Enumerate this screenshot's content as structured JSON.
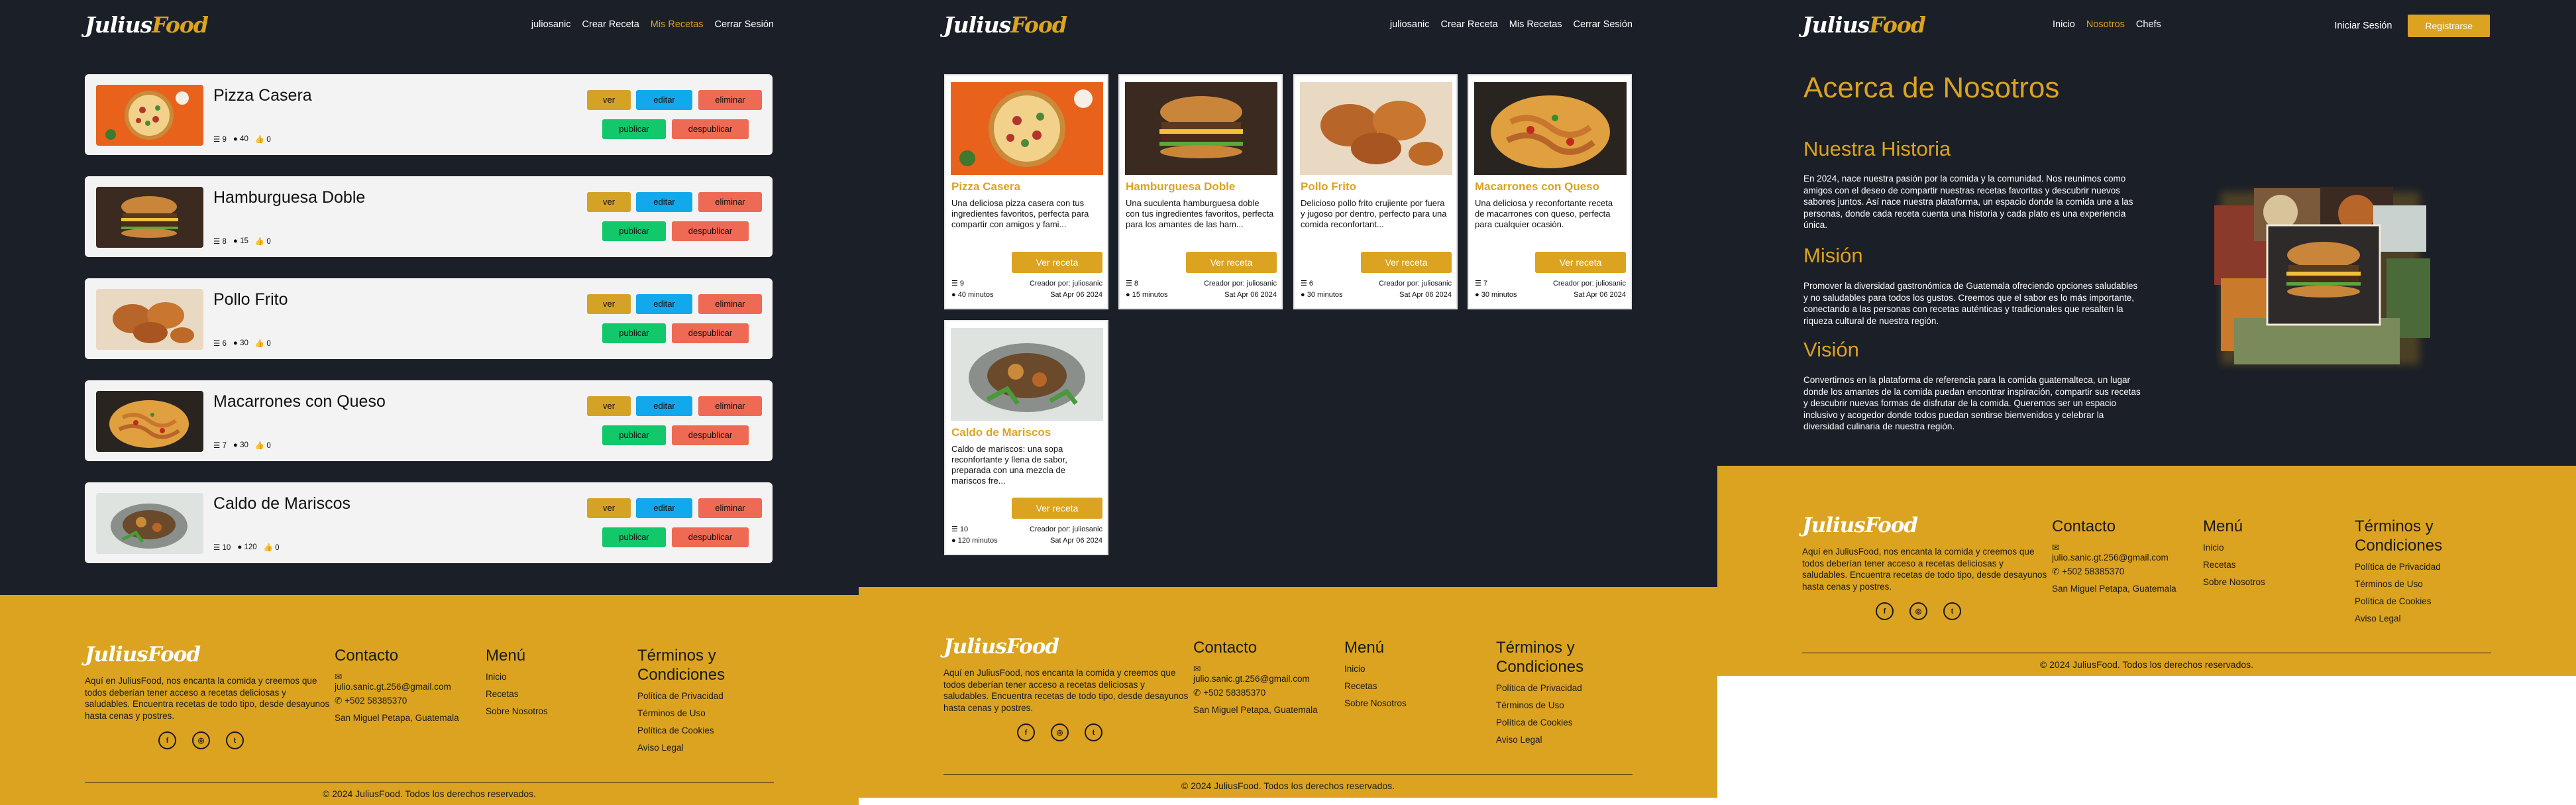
{
  "brand": {
    "part1": "Julius",
    "part2": "Food"
  },
  "nav_auth": {
    "user": "juliosanic",
    "create": "Crear Receta",
    "mine": "Mis Recetas",
    "logout": "Cerrar Sesión"
  },
  "nav_public": {
    "home": "Inicio",
    "about": "Nosotros",
    "chefs": "Chefs",
    "login": "Iniciar Sesión",
    "register": "Registrarse"
  },
  "buttons": {
    "view": "ver",
    "edit": "editar",
    "delete": "eliminar",
    "publish": "publicar",
    "unpublish": "despublicar",
    "view_recipe": "Ver receta"
  },
  "my_recipes": [
    {
      "title": "Pizza Casera",
      "ingredients": "9",
      "minutes": "40",
      "likes": "0"
    },
    {
      "title": "Hamburguesa Doble",
      "ingredients": "8",
      "minutes": "15",
      "likes": "0"
    },
    {
      "title": "Pollo Frito",
      "ingredients": "6",
      "minutes": "30",
      "likes": "0"
    },
    {
      "title": "Macarrones con Queso",
      "ingredients": "7",
      "minutes": "30",
      "likes": "0"
    },
    {
      "title": "Caldo de Mariscos",
      "ingredients": "10",
      "minutes": "120",
      "likes": "0"
    }
  ],
  "grid_recipes": [
    {
      "title": "Pizza Casera",
      "desc": "Una deliciosa pizza casera con tus ingredientes favoritos, perfecta para compartir con amigos y fami...",
      "ingredients": "9",
      "minutes": "40 minutos",
      "creator": "Creador por: juliosanic",
      "date": "Sat Apr 06 2024"
    },
    {
      "title": "Hamburguesa Doble",
      "desc": "Una suculenta hamburguesa doble con tus ingredientes favoritos, perfecta para los amantes de las ham...",
      "ingredients": "8",
      "minutes": "15 minutos",
      "creator": "Creador por: juliosanic",
      "date": "Sat Apr 06 2024"
    },
    {
      "title": "Pollo Frito",
      "desc": "Delicioso pollo frito crujiente por fuera y jugoso por dentro, perfecto para una comida reconfortant...",
      "ingredients": "6",
      "minutes": "30 minutos",
      "creator": "Creador por: juliosanic",
      "date": "Sat Apr 06 2024"
    },
    {
      "title": "Macarrones con Queso",
      "desc": "Una deliciosa y reconfortante receta de macarrones con queso, perfecta para cualquier ocasión.",
      "ingredients": "7",
      "minutes": "30 minutos",
      "creator": "Creador por: juliosanic",
      "date": "Sat Apr 06 2024"
    },
    {
      "title": "Caldo de Mariscos",
      "desc": "Caldo de mariscos: una sopa reconfortante y llena de sabor, preparada con una mezcla de mariscos fre...",
      "ingredients": "10",
      "minutes": "120 minutos",
      "creator": "Creador por: juliosanic",
      "date": "Sat Apr 06 2024"
    }
  ],
  "about": {
    "title": "Acerca de Nosotros",
    "history_title": "Nuestra Historia",
    "history": "En 2024, nace nuestra pasión por la comida y la comunidad. Nos reunimos como amigos con el deseo de compartir nuestras recetas favoritas y descubrir nuevos sabores juntos. Así nace nuestra plataforma, un espacio donde la comida une a las personas, donde cada receta cuenta una historia y cada plato es una experiencia única.",
    "mission_title": "Misión",
    "mission": "Promover la diversidad gastronómica de Guatemala ofreciendo opciones saludables y no saludables para todos los gustos. Creemos que el sabor es lo más importante, conectando a las personas con recetas auténticas y tradicionales que resalten la riqueza cultural de nuestra región.",
    "vision_title": "Visión",
    "vision": "Convertirnos en la plataforma de referencia para la comida guatemalteca, un lugar donde los amantes de la comida puedan encontrar inspiración, compartir sus recetas y descubrir nuevas formas de disfrutar de la comida. Queremos ser un espacio inclusivo y acogedor donde todos puedan sentirse bienvenidos y celebrar la diversidad culinaria de nuestra región."
  },
  "footer": {
    "about": "Aquí en JuliusFood, nos encanta la comida y creemos que todos deberían tener acceso a recetas deliciosas y saludables. Encuentra recetas de todo tipo, desde desayunos hasta cenas y postres.",
    "contact_title": "Contacto",
    "email": "julio.sanic.gt.256@gmail.com",
    "phone": "+502 58385370",
    "address": "San Miguel Petapa, Guatemala",
    "menu_title": "Menú",
    "menu": [
      "Inicio",
      "Recetas",
      "Sobre Nosotros"
    ],
    "terms_title": "Términos y Condiciones",
    "terms": [
      "Política de Privacidad",
      "Términos de Uso",
      "Política de Cookies",
      "Aviso Legal"
    ],
    "copyright": "© 2024 JuliusFood. Todos los derechos reservados."
  },
  "icons": {
    "social": [
      "facebook-icon",
      "instagram-icon",
      "twitter-icon"
    ],
    "accent": "#dba320",
    "dark": "#1b1f27"
  }
}
